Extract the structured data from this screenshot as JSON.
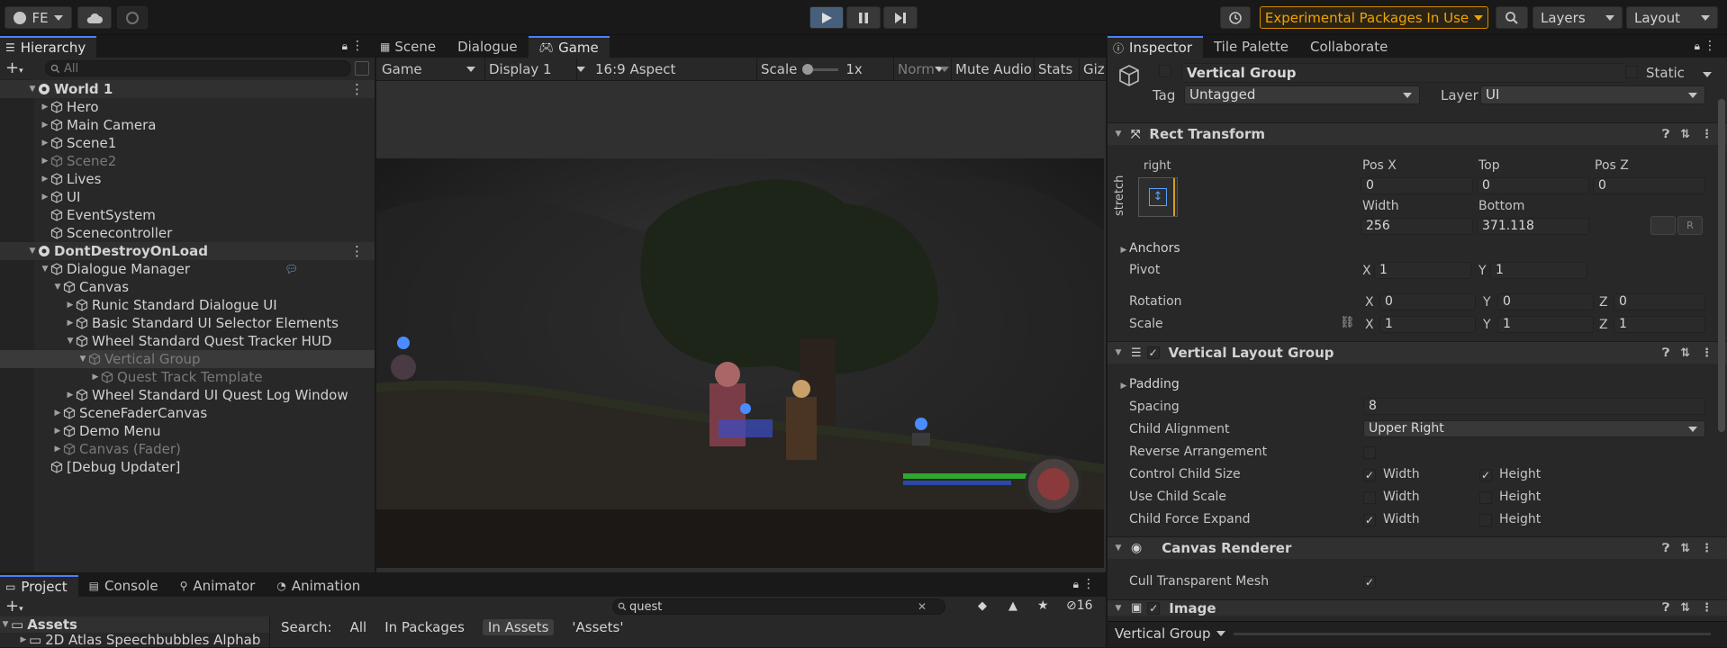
{
  "toolbar": {
    "account": "FE",
    "experimental": "Experimental Packages In Use",
    "layers": "Layers",
    "layout": "Layout"
  },
  "hierarchy": {
    "tab": "Hierarchy",
    "search_placeholder": "All",
    "rows": [
      {
        "label": "World 1",
        "depth": 0,
        "kind": "scene"
      },
      {
        "label": "Hero",
        "depth": 1,
        "kind": "go"
      },
      {
        "label": "Main Camera",
        "depth": 1,
        "kind": "go"
      },
      {
        "label": "Scene1",
        "depth": 1,
        "kind": "go"
      },
      {
        "label": "Scene2",
        "depth": 1,
        "kind": "go-dim"
      },
      {
        "label": "Lives",
        "depth": 1,
        "kind": "go"
      },
      {
        "label": "UI",
        "depth": 1,
        "kind": "go"
      },
      {
        "label": "EventSystem",
        "depth": 1,
        "kind": "go"
      },
      {
        "label": "Scenecontroller",
        "depth": 1,
        "kind": "go"
      },
      {
        "label": "DontDestroyOnLoad",
        "depth": 0,
        "kind": "scene"
      },
      {
        "label": "Dialogue Manager",
        "depth": 1,
        "kind": "go"
      },
      {
        "label": "Canvas",
        "depth": 2,
        "kind": "go"
      },
      {
        "label": "Runic Standard Dialogue UI",
        "depth": 3,
        "kind": "go"
      },
      {
        "label": "Basic Standard UI Selector Elements",
        "depth": 3,
        "kind": "go"
      },
      {
        "label": "Wheel Standard Quest Tracker HUD",
        "depth": 3,
        "kind": "go"
      },
      {
        "label": "Vertical Group",
        "depth": 4,
        "kind": "go-sel"
      },
      {
        "label": "Quest Track Template",
        "depth": 5,
        "kind": "go-dim"
      },
      {
        "label": "Wheel Standard UI Quest Log Window",
        "depth": 3,
        "kind": "go"
      },
      {
        "label": "SceneFaderCanvas",
        "depth": 2,
        "kind": "go"
      },
      {
        "label": "Demo Menu",
        "depth": 2,
        "kind": "go"
      },
      {
        "label": "Canvas (Fader)",
        "depth": 2,
        "kind": "go-dim"
      },
      {
        "label": "[Debug Updater]",
        "depth": 1,
        "kind": "go"
      }
    ]
  },
  "game": {
    "tabs": [
      "Scene",
      "Dialogue",
      "Game"
    ],
    "toolbar": {
      "mode": "Game",
      "display": "Display 1",
      "aspect": "16:9 Aspect",
      "scale_label": "Scale",
      "scale_value": "1x",
      "norm": "Norm",
      "mute": "Mute Audio",
      "stats": "Stats",
      "gizmos": "Giz"
    }
  },
  "project": {
    "tabs": [
      "Project",
      "Console",
      "Animator",
      "Animation"
    ],
    "search_value": "quest",
    "filter_count": "16",
    "tree_root": "Assets",
    "tree_child": "2D Atlas Speechbubbles Alphab",
    "search_label": "Search:",
    "scopes": [
      "All",
      "In Packages",
      "In Assets",
      "'Assets'"
    ]
  },
  "inspector": {
    "tabs": [
      "Inspector",
      "Tile Palette",
      "Collaborate"
    ],
    "object_name": "Vertical Group",
    "static_label": "Static",
    "tag_label": "Tag",
    "tag_value": "Untagged",
    "layer_label": "Layer",
    "layer_value": "UI",
    "rect": {
      "title": "Rect Transform",
      "anchor_h": "right",
      "anchor_v": "stretch",
      "posx_label": "Pos X",
      "posx": "0",
      "top_label": "Top",
      "top": "0",
      "posz_label": "Pos Z",
      "posz": "0",
      "width_label": "Width",
      "width": "256",
      "bottom_label": "Bottom",
      "bottom": "371.118",
      "anchors_label": "Anchors",
      "pivot_label": "Pivot",
      "pivot_x": "1",
      "pivot_y": "1",
      "rotation_label": "Rotation",
      "rot_x": "0",
      "rot_y": "0",
      "rot_z": "0",
      "scale_label": "Scale",
      "scale_x": "1",
      "scale_y": "1",
      "scale_z": "1",
      "x": "X",
      "y": "Y",
      "z": "Z"
    },
    "vlg": {
      "title": "Vertical Layout Group",
      "padding": "Padding",
      "spacing_label": "Spacing",
      "spacing": "8",
      "child_alignment_label": "Child Alignment",
      "child_alignment": "Upper Right",
      "reverse_label": "Reverse Arrangement",
      "control_label": "Control Child Size",
      "use_scale_label": "Use Child Scale",
      "force_expand_label": "Child Force Expand",
      "width": "Width",
      "height": "Height"
    },
    "canvas_renderer": {
      "title": "Canvas Renderer",
      "cull_label": "Cull Transparent Mesh"
    },
    "image": {
      "title": "Image"
    },
    "footer": "Vertical Group"
  }
}
